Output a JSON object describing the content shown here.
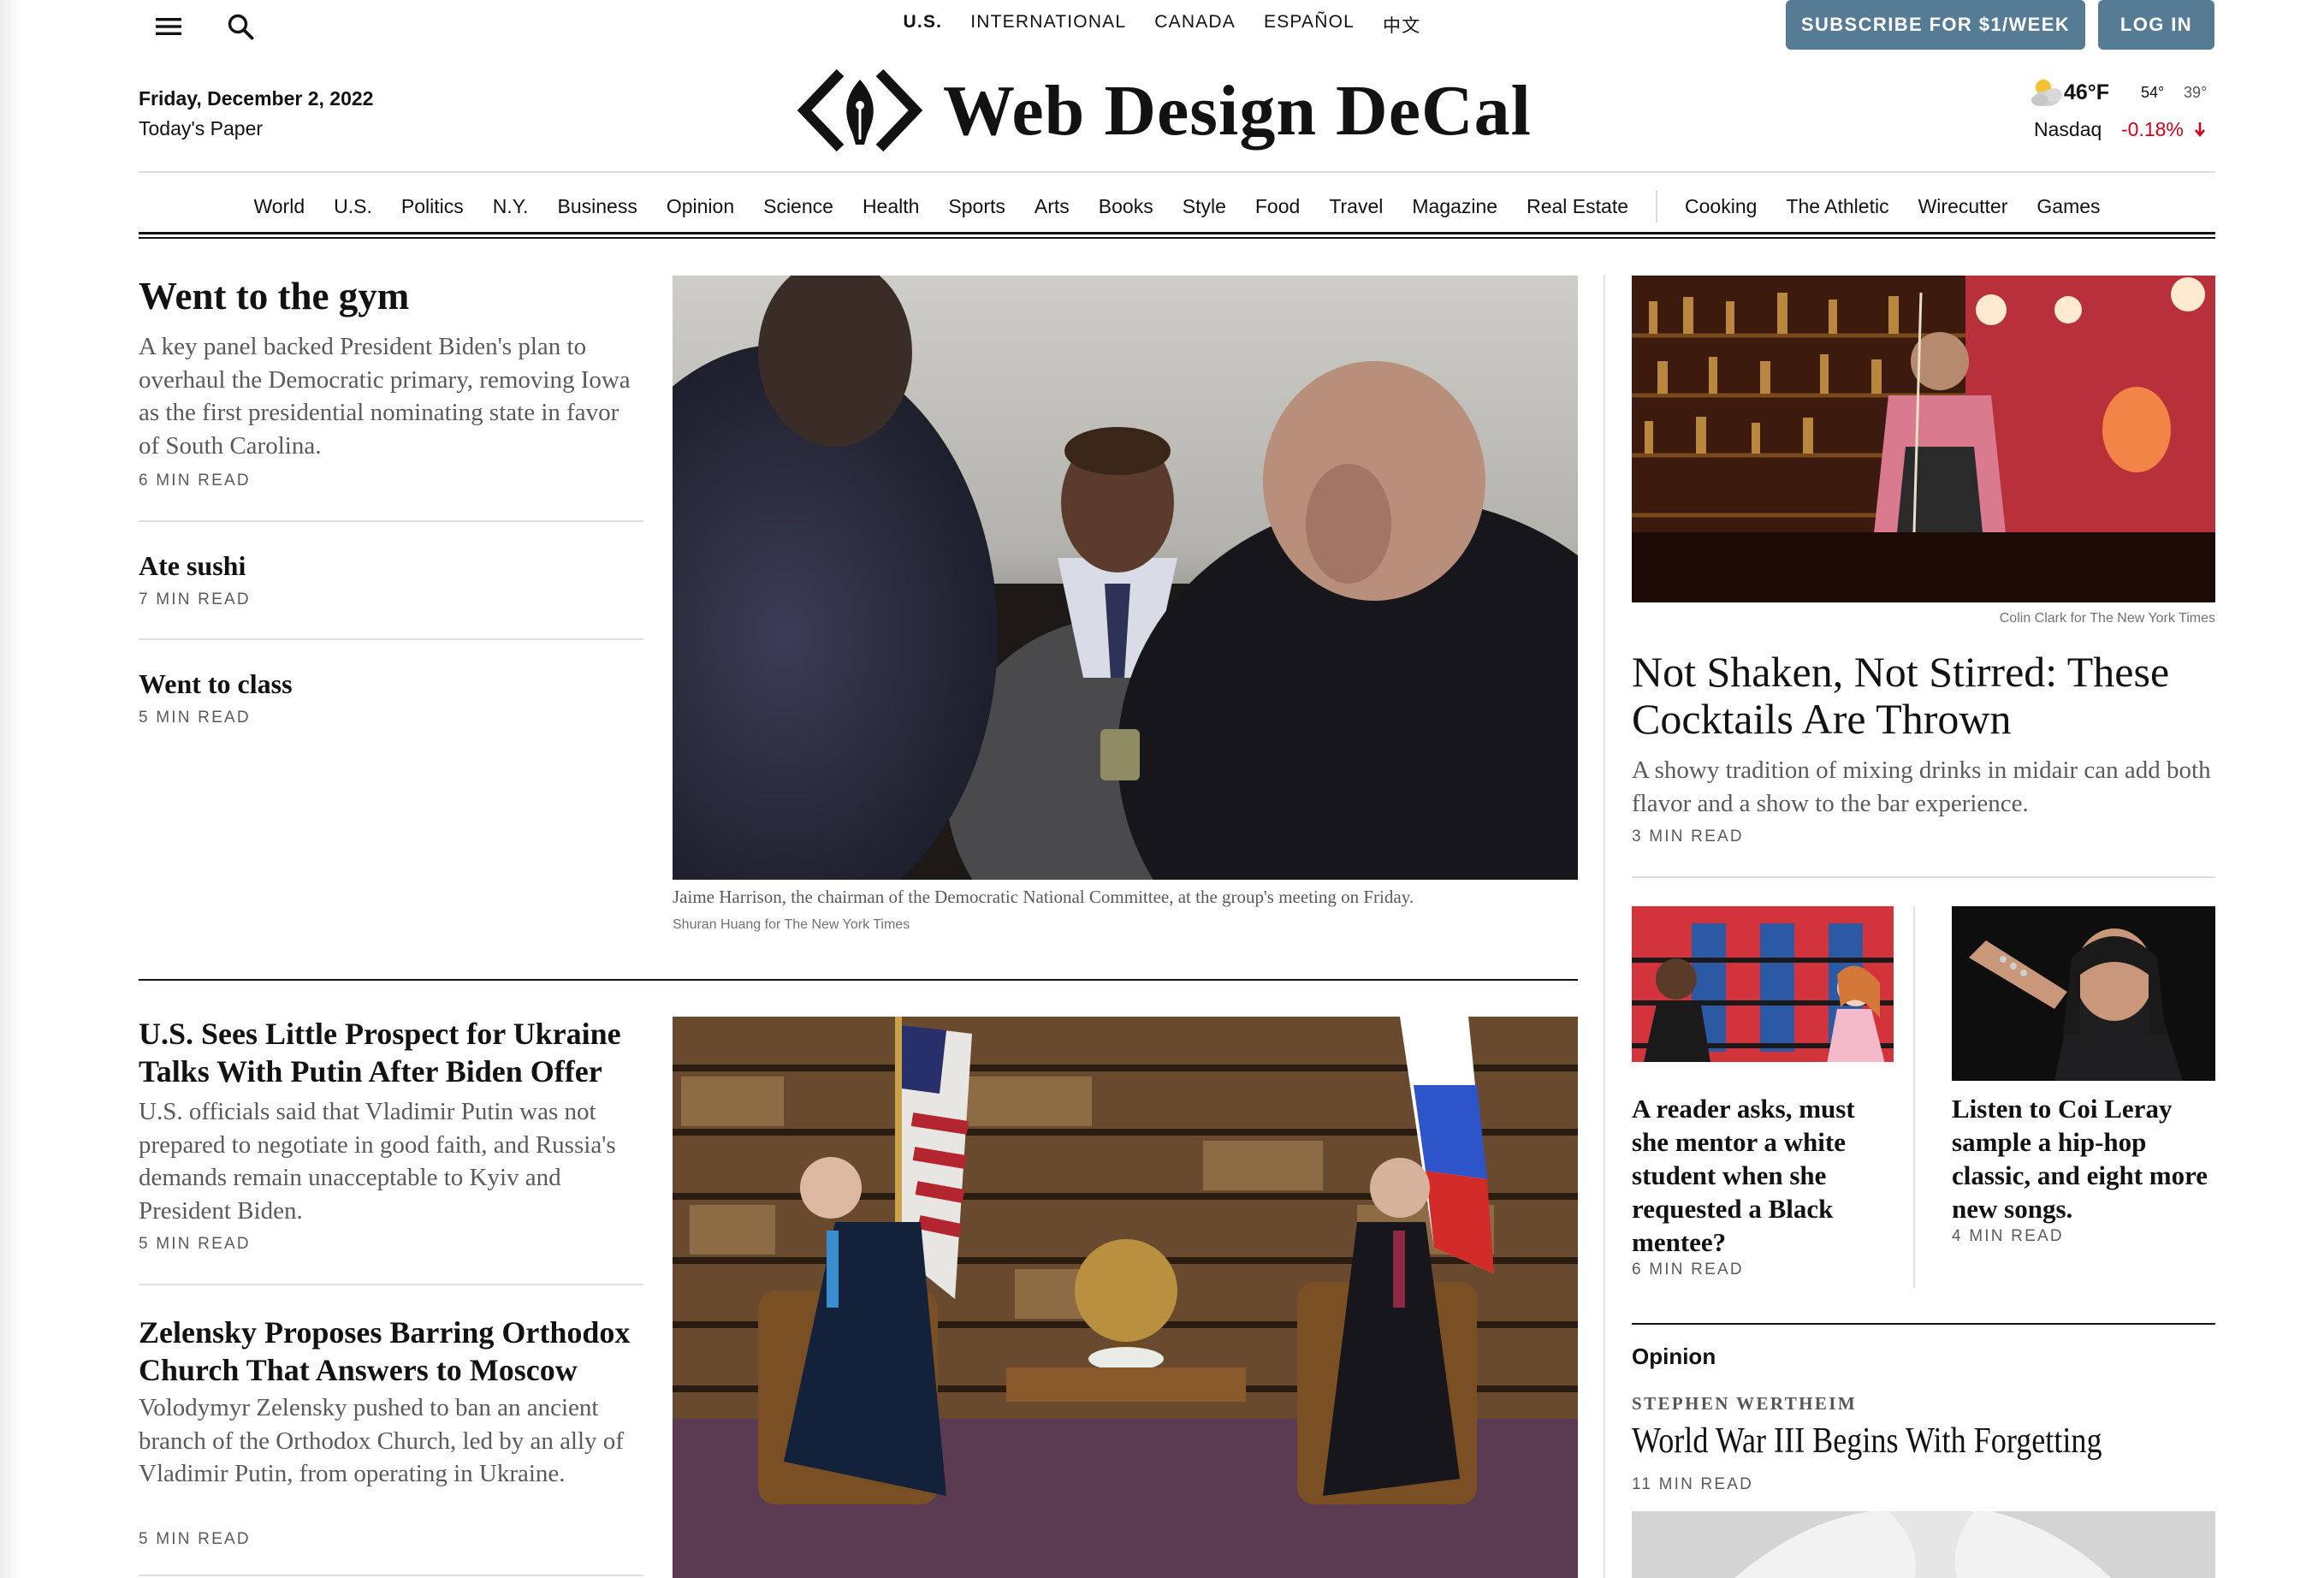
{
  "masthead": {
    "editions": [
      "U.S.",
      "INTERNATIONAL",
      "CANADA",
      "ESPAÑOL",
      "中文"
    ],
    "active_edition": "U.S.",
    "subscribe_label": "SUBSCRIBE FOR $1/WEEK",
    "login_label": "LOG IN",
    "date": "Friday, December 2, 2022",
    "todays_paper": "Today's Paper",
    "title": "Web Design DeCal",
    "weather": {
      "temp": "46°F",
      "high": "54°",
      "low": "39°"
    },
    "market": {
      "name": "Nasdaq",
      "change": "-0.18%",
      "direction": "down"
    }
  },
  "colors": {
    "accent": "#567b95",
    "negative": "#d0021b",
    "text": "#121212",
    "muted": "#5a5a5a"
  },
  "nav": {
    "sections": [
      "World",
      "U.S.",
      "Politics",
      "N.Y.",
      "Business",
      "Opinion",
      "Science",
      "Health",
      "Sports",
      "Arts",
      "Books",
      "Style",
      "Food",
      "Travel",
      "Magazine",
      "Real Estate"
    ],
    "extras": [
      "Cooking",
      "The Athletic",
      "Wirecutter",
      "Games"
    ]
  },
  "lead": {
    "headline": "Went to the gym",
    "summary": "A key panel backed President Biden's plan to overhaul the Democratic primary, removing Iowa as the first presidential nominating state in favor of South Carolina.",
    "read_time": "6 MIN READ",
    "caption": "Jaime Harrison, the chairman of the Democratic National Committee, at the group's meeting on Friday.",
    "credit": "Shuran Huang for The New York Times"
  },
  "brief_stories": [
    {
      "headline": "Ate sushi",
      "read_time": "7 MIN READ"
    },
    {
      "headline": "Went to class",
      "read_time": "5 MIN READ"
    }
  ],
  "ukraine_stories": [
    {
      "headline": "U.S. Sees Little Prospect for Ukraine Talks With Putin After Biden Offer",
      "summary": "U.S. officials said that Vladimir Putin was not prepared to negotiate in good faith, and Russia's demands remain unacceptable to Kyiv and President Biden.",
      "read_time": "5 MIN READ"
    },
    {
      "headline": "Zelensky Proposes Barring Orthodox Church That Answers to Moscow",
      "summary": "Volodymyr Zelensky pushed to ban an ancient branch of the Orthodox Church, led by an ally of Vladimir Putin, from operating in Ukraine.",
      "read_time": "5 MIN READ"
    }
  ],
  "feature": {
    "credit": "Colin Clark for The New York Times",
    "headline": "Not Shaken, Not Stirred: These Cocktails Are Thrown",
    "summary": "A showy tradition of mixing drinks in midair can add both flavor and a show to the bar experience.",
    "read_time": "3 MIN READ"
  },
  "small_features": [
    {
      "headline": "A reader asks, must she mentor a white student when she requested a Black mentee?",
      "read_time": "6 MIN READ"
    },
    {
      "headline": "Listen to Coi Leray sample a hip-hop classic, and eight more new songs.",
      "read_time": "4 MIN READ"
    }
  ],
  "opinion": {
    "label": "Opinion",
    "author": "STEPHEN WERTHEIM",
    "headline": "World War III Begins With Forgetting",
    "read_time": "11 MIN READ"
  }
}
